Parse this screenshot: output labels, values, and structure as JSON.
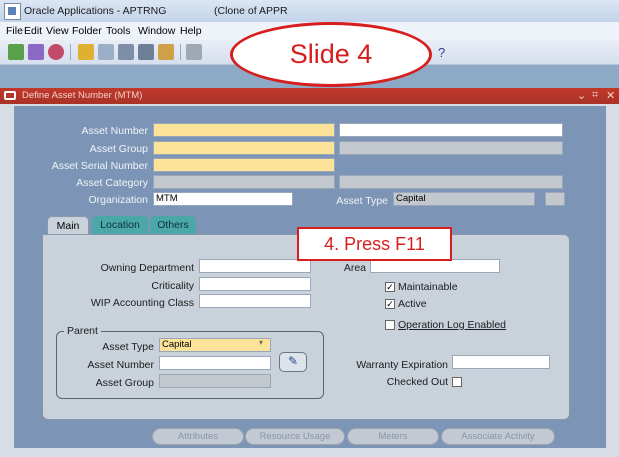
{
  "window": {
    "title": "Oracle Applications - APTRNG",
    "subtitle": "(Clone of APPR"
  },
  "menu": [
    {
      "label": "File"
    },
    {
      "label": "Edit"
    },
    {
      "label": "View"
    },
    {
      "label": "Folder"
    },
    {
      "label": "Tools"
    },
    {
      "label": "Window"
    },
    {
      "label": "Help"
    }
  ],
  "toolbar": {
    "help_glyph": "?"
  },
  "form": {
    "title": "Define Asset Number (MTM)",
    "fields": {
      "asset_number": {
        "label": "Asset Number",
        "value": "",
        "desc": ""
      },
      "asset_group": {
        "label": "Asset Group",
        "value": "",
        "desc": ""
      },
      "asset_serial_number": {
        "label": "Asset Serial Number",
        "value": ""
      },
      "asset_category": {
        "label": "Asset Category",
        "value": "",
        "desc": ""
      },
      "organization": {
        "label": "Organization",
        "value": "MTM"
      },
      "asset_type": {
        "label": "Asset Type",
        "value": "Capital"
      }
    },
    "tabs": [
      {
        "label": "Main",
        "active": true
      },
      {
        "label": "Location",
        "active": false
      },
      {
        "label": "Others",
        "active": false
      }
    ],
    "main": {
      "owning_department": {
        "label": "Owning Department",
        "value": ""
      },
      "criticality": {
        "label": "Criticality",
        "value": ""
      },
      "wip_accounting_class": {
        "label": "WIP Accounting Class",
        "value": ""
      },
      "area_label": "Area",
      "maintainable": {
        "label": "Maintainable",
        "checked": true
      },
      "active": {
        "label": "Active",
        "checked": true
      },
      "operation_log": {
        "label": "Operation Log Enabled",
        "checked": false
      },
      "parent": {
        "legend": "Parent",
        "asset_type": {
          "label": "Asset Type",
          "value": "Capital"
        },
        "asset_number": {
          "label": "Asset  Number",
          "value": ""
        },
        "asset_group": {
          "label": "Asset Group",
          "value": ""
        }
      },
      "warranty_expiration": {
        "label": "Warranty Expiration",
        "value": ""
      },
      "checked_out": {
        "label": "Checked Out",
        "checked": false
      }
    },
    "buttons": [
      {
        "label": "Attributes"
      },
      {
        "label": "Resource Usage"
      },
      {
        "label": "Meters"
      },
      {
        "label": "Associate Activity"
      }
    ]
  },
  "overlays": {
    "slide_label": "Slide 4",
    "instruction": "4. Press F11"
  },
  "colors": {
    "required_field": "#fbe49a",
    "form_background": "#7c95b6",
    "callout_red": "#d71e1e"
  }
}
